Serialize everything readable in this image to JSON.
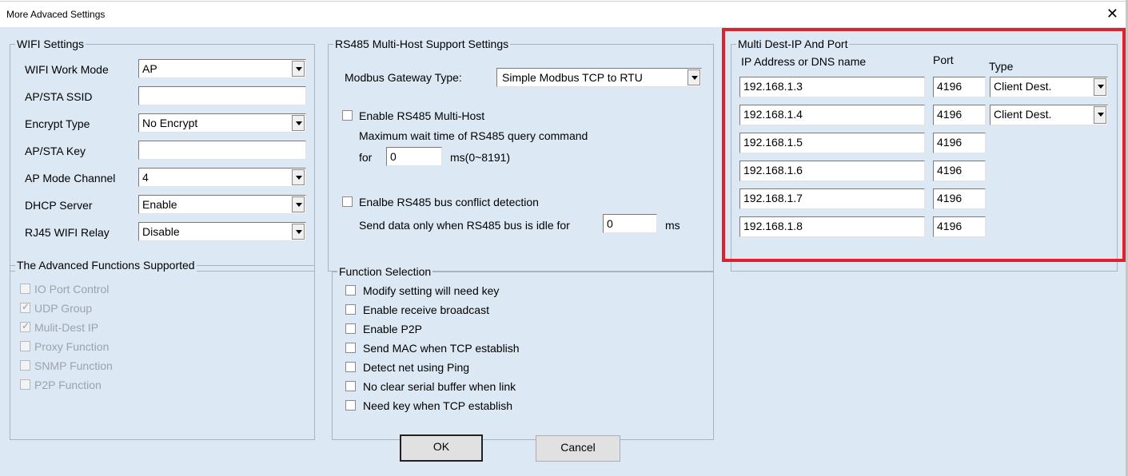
{
  "window": {
    "title": "More Advaced Settings",
    "close_glyph": "✕"
  },
  "wifi": {
    "legend": "WIFI Settings",
    "rows": [
      {
        "label": "WIFI Work Mode",
        "kind": "combo",
        "value": "AP"
      },
      {
        "label": "AP/STA SSID",
        "kind": "edit",
        "value": ""
      },
      {
        "label": "Encrypt Type",
        "kind": "combo",
        "value": "No Encrypt"
      },
      {
        "label": "AP/STA Key",
        "kind": "edit",
        "value": ""
      },
      {
        "label": "AP Mode Channel",
        "kind": "combo",
        "value": "4"
      },
      {
        "label": "DHCP Server",
        "kind": "combo",
        "value": "Enable"
      },
      {
        "label": "RJ45 WIFI Relay",
        "kind": "combo",
        "value": "Disable"
      }
    ]
  },
  "rs485": {
    "legend": "RS485 Multi-Host Support Settings",
    "gateway_label": "Modbus Gateway Type:",
    "gateway_value": "Simple Modbus TCP to RTU",
    "multihost_label": "Enable RS485 Multi-Host",
    "max_wait_label": "Maximum wait time of RS485  query command",
    "for_label": "for",
    "wait_value": "0",
    "wait_unit": "ms(0~8191)",
    "conflict_label": "Enalbe RS485 bus conflict detection",
    "idle_label": "Send data only when RS485 bus is idle for",
    "idle_value": "0",
    "idle_unit": "ms"
  },
  "multidest": {
    "legend": "Multi Dest-IP And Port",
    "col_ip": "IP Address or DNS name",
    "col_port": "Port",
    "col_type": "Type",
    "rows": [
      {
        "ip": "192.168.1.3",
        "port": "4196",
        "type": "Client Dest."
      },
      {
        "ip": "192.168.1.4",
        "port": "4196",
        "type": "Client Dest."
      },
      {
        "ip": "192.168.1.5",
        "port": "4196"
      },
      {
        "ip": "192.168.1.6",
        "port": "4196"
      },
      {
        "ip": "192.168.1.7",
        "port": "4196"
      },
      {
        "ip": "192.168.1.8",
        "port": "4196"
      }
    ]
  },
  "advanced": {
    "legend": "The Advanced Functions Supported",
    "items": [
      {
        "label": "IO Port Control",
        "checked": false
      },
      {
        "label": "UDP Group",
        "checked": true
      },
      {
        "label": "Mulit-Dest IP",
        "checked": true
      },
      {
        "label": "Proxy Function",
        "checked": false
      },
      {
        "label": "SNMP Function",
        "checked": false
      },
      {
        "label": "P2P Function",
        "checked": false
      }
    ]
  },
  "functions": {
    "legend": "Function Selection",
    "items": [
      {
        "label": "Modify setting will need key",
        "checked": false
      },
      {
        "label": "Enable receive broadcast",
        "checked": false
      },
      {
        "label": "Enable P2P",
        "checked": false
      },
      {
        "label": "Send MAC when TCP establish",
        "checked": false
      },
      {
        "label": "Detect net using Ping",
        "checked": false
      },
      {
        "label": "No clear serial buffer when link",
        "checked": false
      },
      {
        "label": "Need key when TCP establish",
        "checked": false
      }
    ]
  },
  "buttons": {
    "ok": "OK",
    "cancel": "Cancel"
  },
  "colors": {
    "dialog_bg": "#dde8f5",
    "highlight": "#e0202a"
  }
}
